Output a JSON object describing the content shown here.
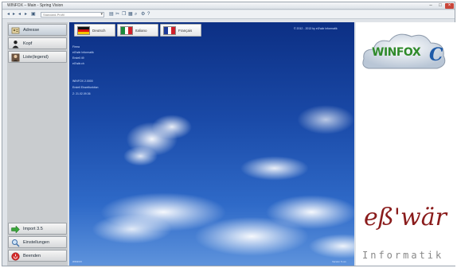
{
  "window": {
    "title": "WINFOX – Main - Spring Vision"
  },
  "toolbar": {
    "profile_placeholder": "Standard-Profil"
  },
  "sidebar": {
    "items": [
      {
        "label": "Adresse",
        "icon": "address-icon"
      },
      {
        "label": "Kopf",
        "icon": "person-icon"
      },
      {
        "label": "Liste(legend)",
        "icon": "contact-photo-icon"
      }
    ],
    "bottom_items": [
      {
        "label": "Import 3.5",
        "icon": "green-arrow-icon"
      },
      {
        "label": "Einstellungen",
        "icon": "magnifier-icon"
      },
      {
        "label": "Beenden",
        "icon": "exit-icon"
      }
    ]
  },
  "languages": [
    {
      "label": "Deutsch",
      "flag": "de"
    },
    {
      "label": "Italiano",
      "flag": "it"
    },
    {
      "label": "Français",
      "flag": "fr"
    }
  ],
  "main": {
    "copyright": "© 2012 - 2013 by eß'wär Informatik",
    "info_lines": [
      "Firma",
      "eß'wär Informatik",
      "Erstell 49",
      "eß'wär.ch",
      "",
      "WINFOX 2.0000",
      "Erstell Einzelfunktion",
      "Z: 21.02.09.36"
    ],
    "status": "WINFOX",
    "version": "Version 5.xxx"
  },
  "branding": {
    "product_logo": "WINFOX",
    "product_logo_c": "C",
    "company_logo": "eß'wär",
    "company_sub": "Informatik"
  },
  "colors": {
    "accent": "#1e5aa8",
    "logo_green": "#2f8a2a",
    "company_red": "#8a1c1c"
  }
}
